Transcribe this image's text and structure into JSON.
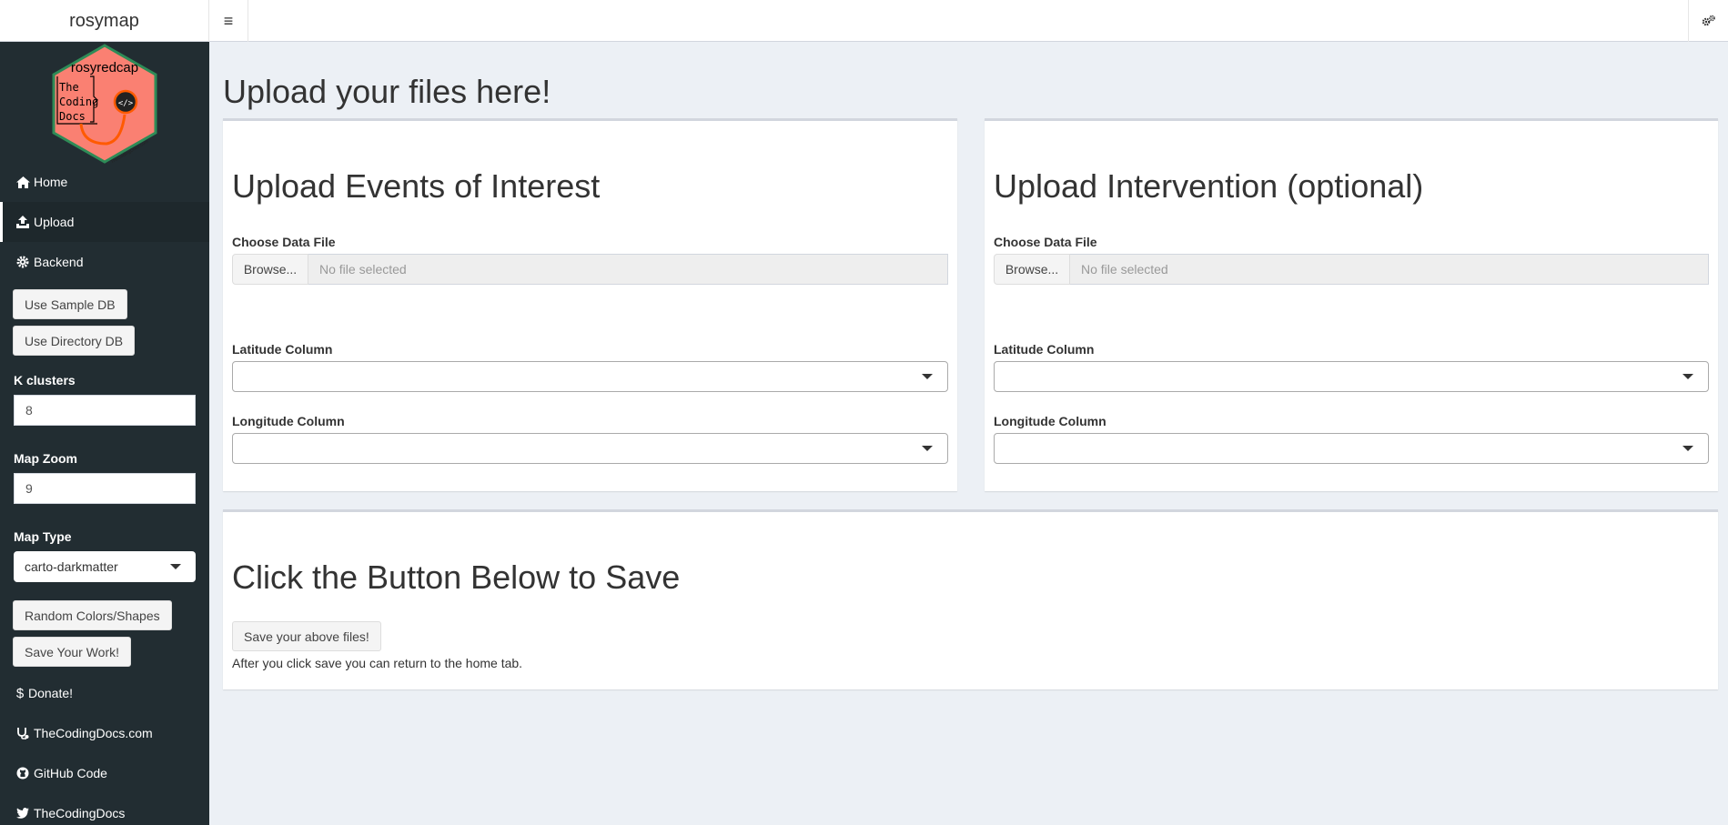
{
  "header": {
    "brand": "rosymap",
    "menu_toggle_glyph": "≡"
  },
  "sidebar": {
    "logo": {
      "title": "rosyredcap",
      "lines": [
        "The",
        "Coding",
        "Docs"
      ],
      "code_glyph": "</>",
      "footer": "TheCodingDocs.com",
      "fill_color": "#fa8072",
      "border_color": "#2e8b57"
    },
    "nav": {
      "home": "Home",
      "upload": "Upload",
      "backend": "Backend",
      "donate": "Donate!",
      "site": "TheCodingDocs.com",
      "github": "GitHub Code",
      "twitter": "TheCodingDocs"
    },
    "buttons": {
      "sample_db": "Use Sample DB",
      "directory_db": "Use Directory DB",
      "random": "Random Colors/Shapes",
      "save_work": "Save Your Work!"
    },
    "k_clusters": {
      "label": "K clusters",
      "value": "8"
    },
    "map_zoom": {
      "label": "Map Zoom",
      "value": "9"
    },
    "map_type": {
      "label": "Map Type",
      "value": "carto-darkmatter"
    }
  },
  "main": {
    "page_title": "Upload your files here!",
    "events_box": {
      "title": "Upload Events of Interest",
      "file_label": "Choose Data File",
      "browse": "Browse...",
      "file_placeholder": "No file selected",
      "lat_label": "Latitude Column",
      "lon_label": "Longitude Column"
    },
    "intervention_box": {
      "title": "Upload Intervention (optional)",
      "file_label": "Choose Data File",
      "browse": "Browse...",
      "file_placeholder": "No file selected",
      "lat_label": "Latitude Column",
      "lon_label": "Longitude Column"
    },
    "save_box": {
      "title": "Click the Button Below to Save",
      "button": "Save your above files!",
      "note": "After you click save you can return to the home tab."
    }
  }
}
